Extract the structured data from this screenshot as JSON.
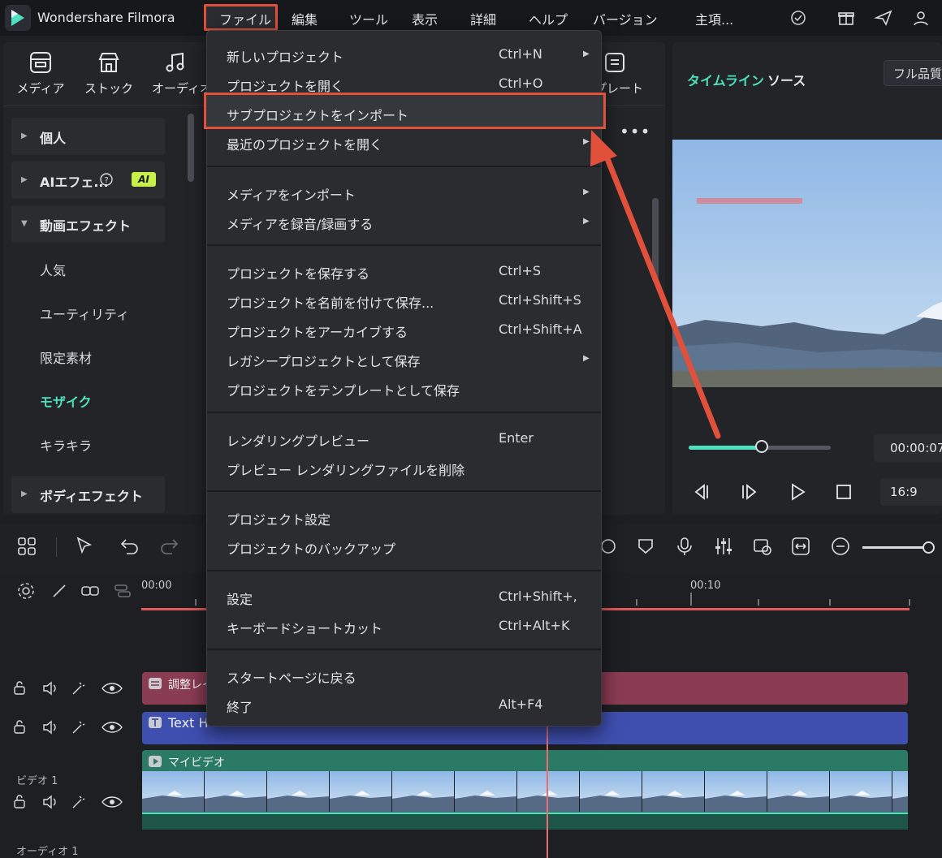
{
  "app": {
    "title": "Wondershare Filmora"
  },
  "menubar": [
    "ファイル",
    "編集",
    "ツール",
    "表示",
    "詳細",
    "ヘルプ",
    "バージョン",
    "主項..."
  ],
  "library_tabs": [
    "メディア",
    "ストック",
    "オーディオ",
    "プレート"
  ],
  "sidebar": {
    "sections": [
      {
        "label": "個人"
      },
      {
        "label": "AIエフェ...",
        "badge": "AI"
      },
      {
        "label": "動画エフェクト"
      }
    ],
    "subitems": [
      "人気",
      "ユーティリティ",
      "限定素材",
      "モザイク",
      "キラキラ"
    ],
    "active_subitem": "モザイク",
    "last_section": "ボディエフェクト"
  },
  "preview": {
    "tabs": {
      "timeline": "タイムライン",
      "source": "ソース"
    },
    "quality": "フル品質",
    "time": "00:00:07",
    "ratio": "16:9",
    "progress_fraction": 0.53
  },
  "timeline": {
    "ruler_labels": [
      "00:00",
      "00:10"
    ],
    "clips": {
      "adjust": "調整レイ",
      "text": "Text H",
      "video": "マイビデオ"
    },
    "track_labels": {
      "video1": "ビデオ 1",
      "audio1": "オーディオ 1"
    }
  },
  "file_menu": {
    "items": [
      {
        "label": "新しいプロジェクト",
        "shortcut": "Ctrl+N",
        "submenu": true
      },
      {
        "label": "プロジェクトを開く",
        "shortcut": "Ctrl+O",
        "submenu": false
      },
      {
        "label": "サブプロジェクトをインポート",
        "shortcut": "",
        "submenu": false,
        "highlighted": true
      },
      {
        "label": "最近のプロジェクトを開く",
        "shortcut": "",
        "submenu": true
      },
      {
        "label": "メディアをインポート",
        "shortcut": "",
        "submenu": true
      },
      {
        "label": "メディアを録音/録画する",
        "shortcut": "",
        "submenu": true
      },
      {
        "label": "プロジェクトを保存する",
        "shortcut": "Ctrl+S",
        "submenu": false
      },
      {
        "label": "プロジェクトを名前を付けて保存...",
        "shortcut": "Ctrl+Shift+S",
        "submenu": false
      },
      {
        "label": "プロジェクトをアーカイブする",
        "shortcut": "Ctrl+Shift+A",
        "submenu": false
      },
      {
        "label": "レガシープロジェクトとして保存",
        "shortcut": "",
        "submenu": true
      },
      {
        "label": "プロジェクトをテンプレートとして保存",
        "shortcut": "",
        "submenu": false
      },
      {
        "label": "レンダリングプレビュー",
        "shortcut": "Enter",
        "submenu": false
      },
      {
        "label": "プレビュー レンダリングファイルを削除",
        "shortcut": "",
        "submenu": false
      },
      {
        "label": "プロジェクト設定",
        "shortcut": "",
        "submenu": false
      },
      {
        "label": "プロジェクトのバックアップ",
        "shortcut": "",
        "submenu": false
      },
      {
        "label": "設定",
        "shortcut": "Ctrl+Shift+,",
        "submenu": false
      },
      {
        "label": "キーボードショートカット",
        "shortcut": "Ctrl+Alt+K",
        "submenu": false
      },
      {
        "label": "スタートページに戻る",
        "shortcut": "",
        "submenu": false
      },
      {
        "label": "終了",
        "shortcut": "Alt+F4",
        "submenu": false
      }
    ]
  },
  "colors": {
    "accent": "#4fe0c0",
    "annotation": "#e0503a",
    "playhead": "#ee6b6b"
  },
  "icons": [
    "app-logo-icon",
    "check-circle-icon",
    "gift-icon",
    "send-icon",
    "user-icon",
    "media-icon",
    "stock-icon",
    "audio-icon",
    "template-icon",
    "more-icon",
    "prev-frame-icon",
    "next-frame-icon",
    "play-icon",
    "stop-icon",
    "layout-icon",
    "select-icon",
    "undo-icon",
    "redo-icon",
    "lock-icon",
    "speaker-icon",
    "magic-icon",
    "eye-icon",
    "zoom-out-icon"
  ]
}
